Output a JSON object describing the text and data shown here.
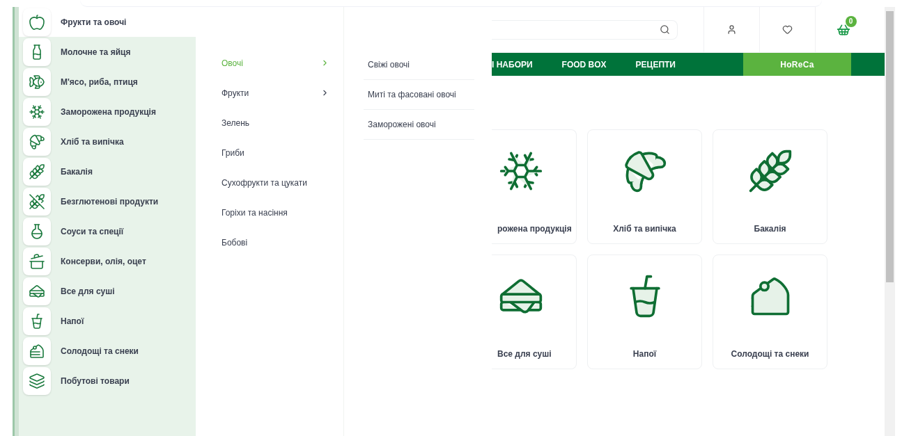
{
  "categories": [
    {
      "label": "Фрукти та овочі",
      "selected": true
    },
    {
      "label": "Молочне та яйця",
      "selected": false
    },
    {
      "label": "М'ясо, риба, птиця",
      "selected": false
    },
    {
      "label": "Заморожена продукція",
      "selected": false
    },
    {
      "label": "Хліб та випічка",
      "selected": false
    },
    {
      "label": "Бакалія",
      "selected": false
    },
    {
      "label": "Безглютенові продукти",
      "selected": false
    },
    {
      "label": "Соуси та спеції",
      "selected": false
    },
    {
      "label": "Консерви, олія, оцет",
      "selected": false
    },
    {
      "label": "Все для суші",
      "selected": false
    },
    {
      "label": "Напої",
      "selected": false
    },
    {
      "label": "Солодощі та снеки",
      "selected": false
    },
    {
      "label": "Побутові товари",
      "selected": false
    }
  ],
  "subcategories": [
    {
      "label": "Овочі",
      "selected": true,
      "expandable": true
    },
    {
      "label": "Фрукти",
      "selected": false,
      "expandable": true
    },
    {
      "label": "Зелень",
      "selected": false,
      "expandable": false
    },
    {
      "label": "Гриби",
      "selected": false,
      "expandable": false
    },
    {
      "label": "Сухофрукти та цукати",
      "selected": false,
      "expandable": false
    },
    {
      "label": "Горіхи та насіння",
      "selected": false,
      "expandable": false
    },
    {
      "label": "Бобові",
      "selected": false,
      "expandable": false
    }
  ],
  "subsubcategories": [
    "Свіжі овочі",
    "Миті та фасовані овочі",
    "Заморожені овочі"
  ],
  "header": {
    "cart_count": "0"
  },
  "nav": [
    {
      "label": "І НАБОРИ",
      "selected": false
    },
    {
      "label": "FOOD BOX",
      "selected": false
    },
    {
      "label": "РЕЦЕПТИ",
      "selected": false
    },
    {
      "label": "HoReCa",
      "selected": true
    }
  ],
  "cards": [
    {
      "label": "рожена продукція",
      "cut": true
    },
    {
      "label": "Хліб та випічка",
      "cut": false
    },
    {
      "label": "Бакалія",
      "cut": false
    },
    {
      "label": "Все для суші",
      "cut": true
    },
    {
      "label": "Напої",
      "cut": false
    },
    {
      "label": "Солодощі та снеки",
      "cut": false
    }
  ]
}
